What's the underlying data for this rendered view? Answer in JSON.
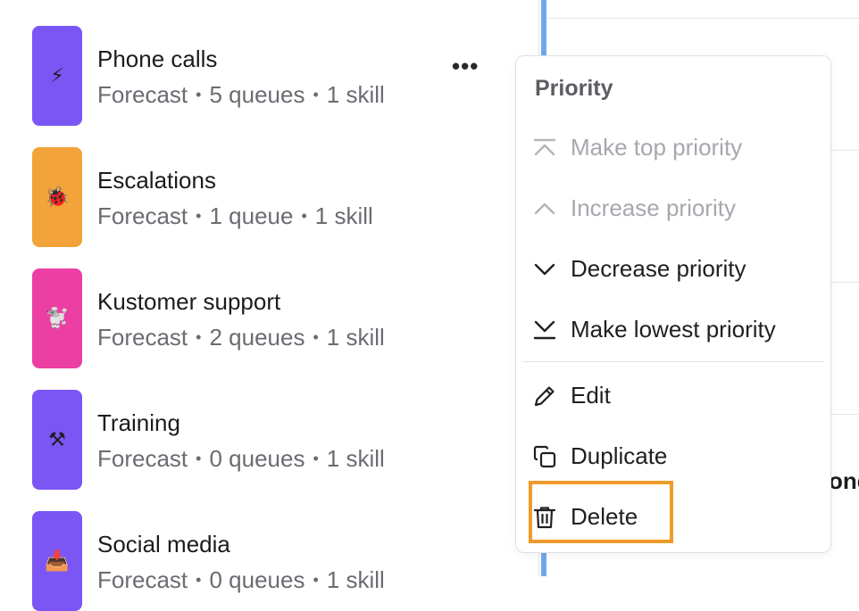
{
  "queues": [
    {
      "title": "Phone calls",
      "forecast": "Forecast",
      "queues": "5 queues",
      "skills": "1 skill",
      "color": "#7b56f5",
      "icon": "⚡",
      "icon_name": "lightning-icon"
    },
    {
      "title": "Escalations",
      "forecast": "Forecast",
      "queues": "1 queue",
      "skills": "1 skill",
      "color": "#f2a33a",
      "icon": "🐞",
      "icon_name": "ladybug-icon"
    },
    {
      "title": "Kustomer support",
      "forecast": "Forecast",
      "queues": "2 queues",
      "skills": "1 skill",
      "color": "#ec3fa4",
      "icon": "🐩",
      "icon_name": "poodle-icon"
    },
    {
      "title": "Training",
      "forecast": "Forecast",
      "queues": "0 queues",
      "skills": "1 skill",
      "color": "#7b56f5",
      "icon": "⚒",
      "icon_name": "hammer-pick-icon"
    },
    {
      "title": "Social media",
      "forecast": "Forecast",
      "queues": "0 queues",
      "skills": "1 skill",
      "color": "#7b56f5",
      "icon": "📥",
      "icon_name": "inbox-tray-icon"
    }
  ],
  "more_button": "•••",
  "background_text": "one",
  "menu": {
    "header": "Priority",
    "items": [
      {
        "label": "Make top priority",
        "icon": "top-priority-icon",
        "disabled": true
      },
      {
        "label": "Increase priority",
        "icon": "chevron-up-icon",
        "disabled": true
      },
      {
        "label": "Decrease priority",
        "icon": "chevron-down-icon",
        "disabled": false
      },
      {
        "label": "Make lowest priority",
        "icon": "lowest-priority-icon",
        "disabled": false
      },
      {
        "label": "Edit",
        "icon": "pencil-icon",
        "disabled": false
      },
      {
        "label": "Duplicate",
        "icon": "duplicate-icon",
        "disabled": false
      },
      {
        "label": "Delete",
        "icon": "trash-icon",
        "disabled": false
      }
    ]
  },
  "colors": {
    "highlight": "#f09a2a",
    "accent_line": "#6fa8ea"
  }
}
